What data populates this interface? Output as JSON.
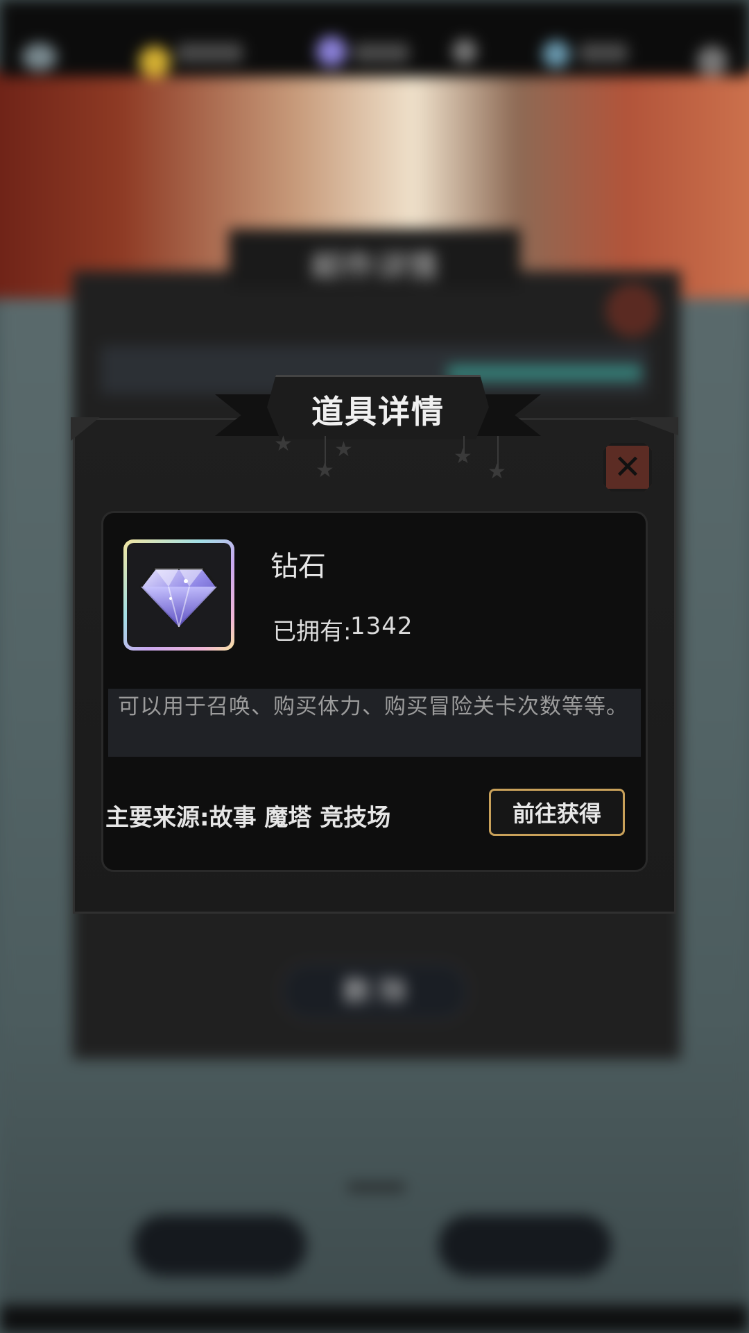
{
  "dialog": {
    "title": "道具详情",
    "item_name": "钻石",
    "owned_label": "已拥有:",
    "owned_count": "1342",
    "description": "可以用于召唤、购买体力、购买冒险关卡次数等等。",
    "sources_label": "主要来源:故事 魔塔 竞技场",
    "goto_button_label": "前往获得",
    "close_icon": "close-icon",
    "item_icon": "diamond-icon"
  },
  "colors": {
    "panel_bg": "#1c1c1c",
    "inner_bg": "#0e0e0e",
    "close_red": "#5c2c24",
    "goto_border_gold": "#c9a15a",
    "description_bg": "#202226"
  },
  "background_screen": {
    "panel_title": "邮件详情",
    "delete_button_label": "删 除"
  }
}
